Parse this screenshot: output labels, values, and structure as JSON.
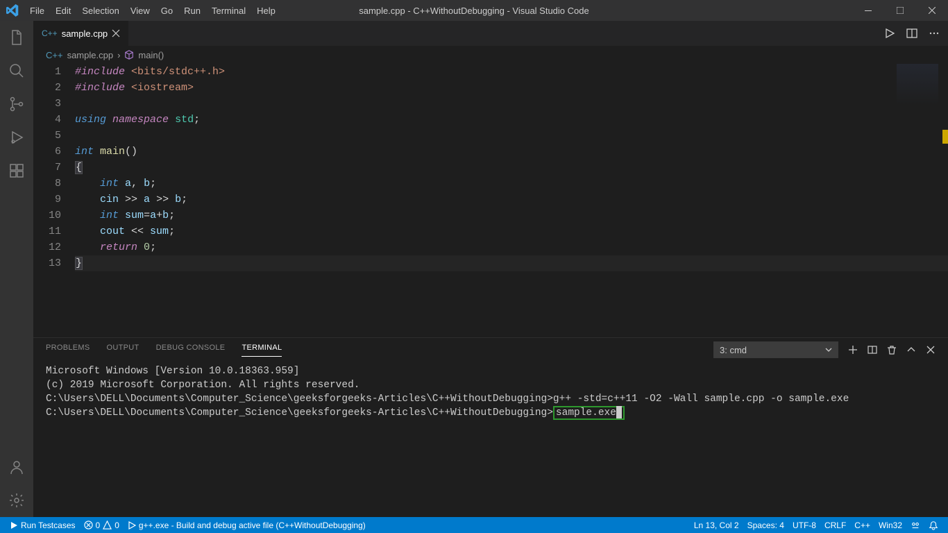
{
  "titlebar": {
    "menus": [
      "File",
      "Edit",
      "Selection",
      "View",
      "Go",
      "Run",
      "Terminal",
      "Help"
    ],
    "title": "sample.cpp - C++WithoutDebugging - Visual Studio Code"
  },
  "tab": {
    "icon_label": "C++",
    "filename": "sample.cpp"
  },
  "breadcrumbs": {
    "file": "sample.cpp",
    "symbol": "main()"
  },
  "code": {
    "lines": [
      {
        "n": 1,
        "tokens": [
          [
            "kw",
            "#include"
          ],
          [
            "op",
            " "
          ],
          [
            "inc",
            "<bits/stdc++.h>"
          ]
        ]
      },
      {
        "n": 2,
        "tokens": [
          [
            "kw",
            "#include"
          ],
          [
            "op",
            " "
          ],
          [
            "inc",
            "<iostream>"
          ]
        ]
      },
      {
        "n": 3,
        "tokens": [
          [
            "op",
            ""
          ]
        ]
      },
      {
        "n": 4,
        "tokens": [
          [
            "kw2",
            "using"
          ],
          [
            "op",
            " "
          ],
          [
            "kw",
            "namespace"
          ],
          [
            "op",
            " "
          ],
          [
            "type",
            "std"
          ],
          [
            "op",
            ";"
          ]
        ]
      },
      {
        "n": 5,
        "tokens": [
          [
            "op",
            ""
          ]
        ]
      },
      {
        "n": 6,
        "tokens": [
          [
            "kw2",
            "int"
          ],
          [
            "op",
            " "
          ],
          [
            "fn",
            "main"
          ],
          [
            "op",
            "()"
          ]
        ]
      },
      {
        "n": 7,
        "tokens": [
          [
            "hlbrace",
            "{"
          ]
        ]
      },
      {
        "n": 8,
        "tokens": [
          [
            "op",
            "    "
          ],
          [
            "kw2",
            "int"
          ],
          [
            "op",
            " "
          ],
          [
            "var",
            "a"
          ],
          [
            "op",
            ", "
          ],
          [
            "var",
            "b"
          ],
          [
            "op",
            ";"
          ]
        ]
      },
      {
        "n": 9,
        "tokens": [
          [
            "op",
            "    "
          ],
          [
            "var",
            "cin"
          ],
          [
            "op",
            " >> "
          ],
          [
            "var",
            "a"
          ],
          [
            "op",
            " >> "
          ],
          [
            "var",
            "b"
          ],
          [
            "op",
            ";"
          ]
        ]
      },
      {
        "n": 10,
        "tokens": [
          [
            "op",
            "    "
          ],
          [
            "kw2",
            "int"
          ],
          [
            "op",
            " "
          ],
          [
            "var",
            "sum"
          ],
          [
            "op",
            "="
          ],
          [
            "var",
            "a"
          ],
          [
            "op",
            "+"
          ],
          [
            "var",
            "b"
          ],
          [
            "op",
            ";"
          ]
        ]
      },
      {
        "n": 11,
        "tokens": [
          [
            "op",
            "    "
          ],
          [
            "var",
            "cout"
          ],
          [
            "op",
            " << "
          ],
          [
            "var",
            "sum"
          ],
          [
            "op",
            ";"
          ]
        ]
      },
      {
        "n": 12,
        "tokens": [
          [
            "op",
            "    "
          ],
          [
            "kw",
            "return"
          ],
          [
            "op",
            " "
          ],
          [
            "num",
            "0"
          ],
          [
            "op",
            ";"
          ]
        ]
      },
      {
        "n": 13,
        "tokens": [
          [
            "hlbrace",
            "}"
          ]
        ],
        "current": true
      }
    ]
  },
  "panel": {
    "tabs": [
      "PROBLEMS",
      "OUTPUT",
      "DEBUG CONSOLE",
      "TERMINAL"
    ],
    "active_tab": "TERMINAL",
    "terminal_select": "3: cmd",
    "terminal_lines": [
      "Microsoft Windows [Version 10.0.18363.959]",
      "(c) 2019 Microsoft Corporation. All rights reserved.",
      "",
      "C:\\Users\\DELL\\Documents\\Computer_Science\\geeksforgeeks-Articles\\C++WithoutDebugging>g++ -std=c++11 -O2 -Wall sample.cpp -o sample.exe",
      ""
    ],
    "terminal_prompt": "C:\\Users\\DELL\\Documents\\Computer_Science\\geeksforgeeks-Articles\\C++WithoutDebugging>",
    "terminal_exe": "sample.exe"
  },
  "statusbar": {
    "run_testcases": "Run Testcases",
    "errors": "0",
    "warnings": "0",
    "build_task": "g++.exe - Build and debug active file (C++WithoutDebugging)",
    "line_col": "Ln 13, Col 2",
    "spaces": "Spaces: 4",
    "encoding": "UTF-8",
    "eol": "CRLF",
    "lang": "C++",
    "platform": "Win32"
  }
}
